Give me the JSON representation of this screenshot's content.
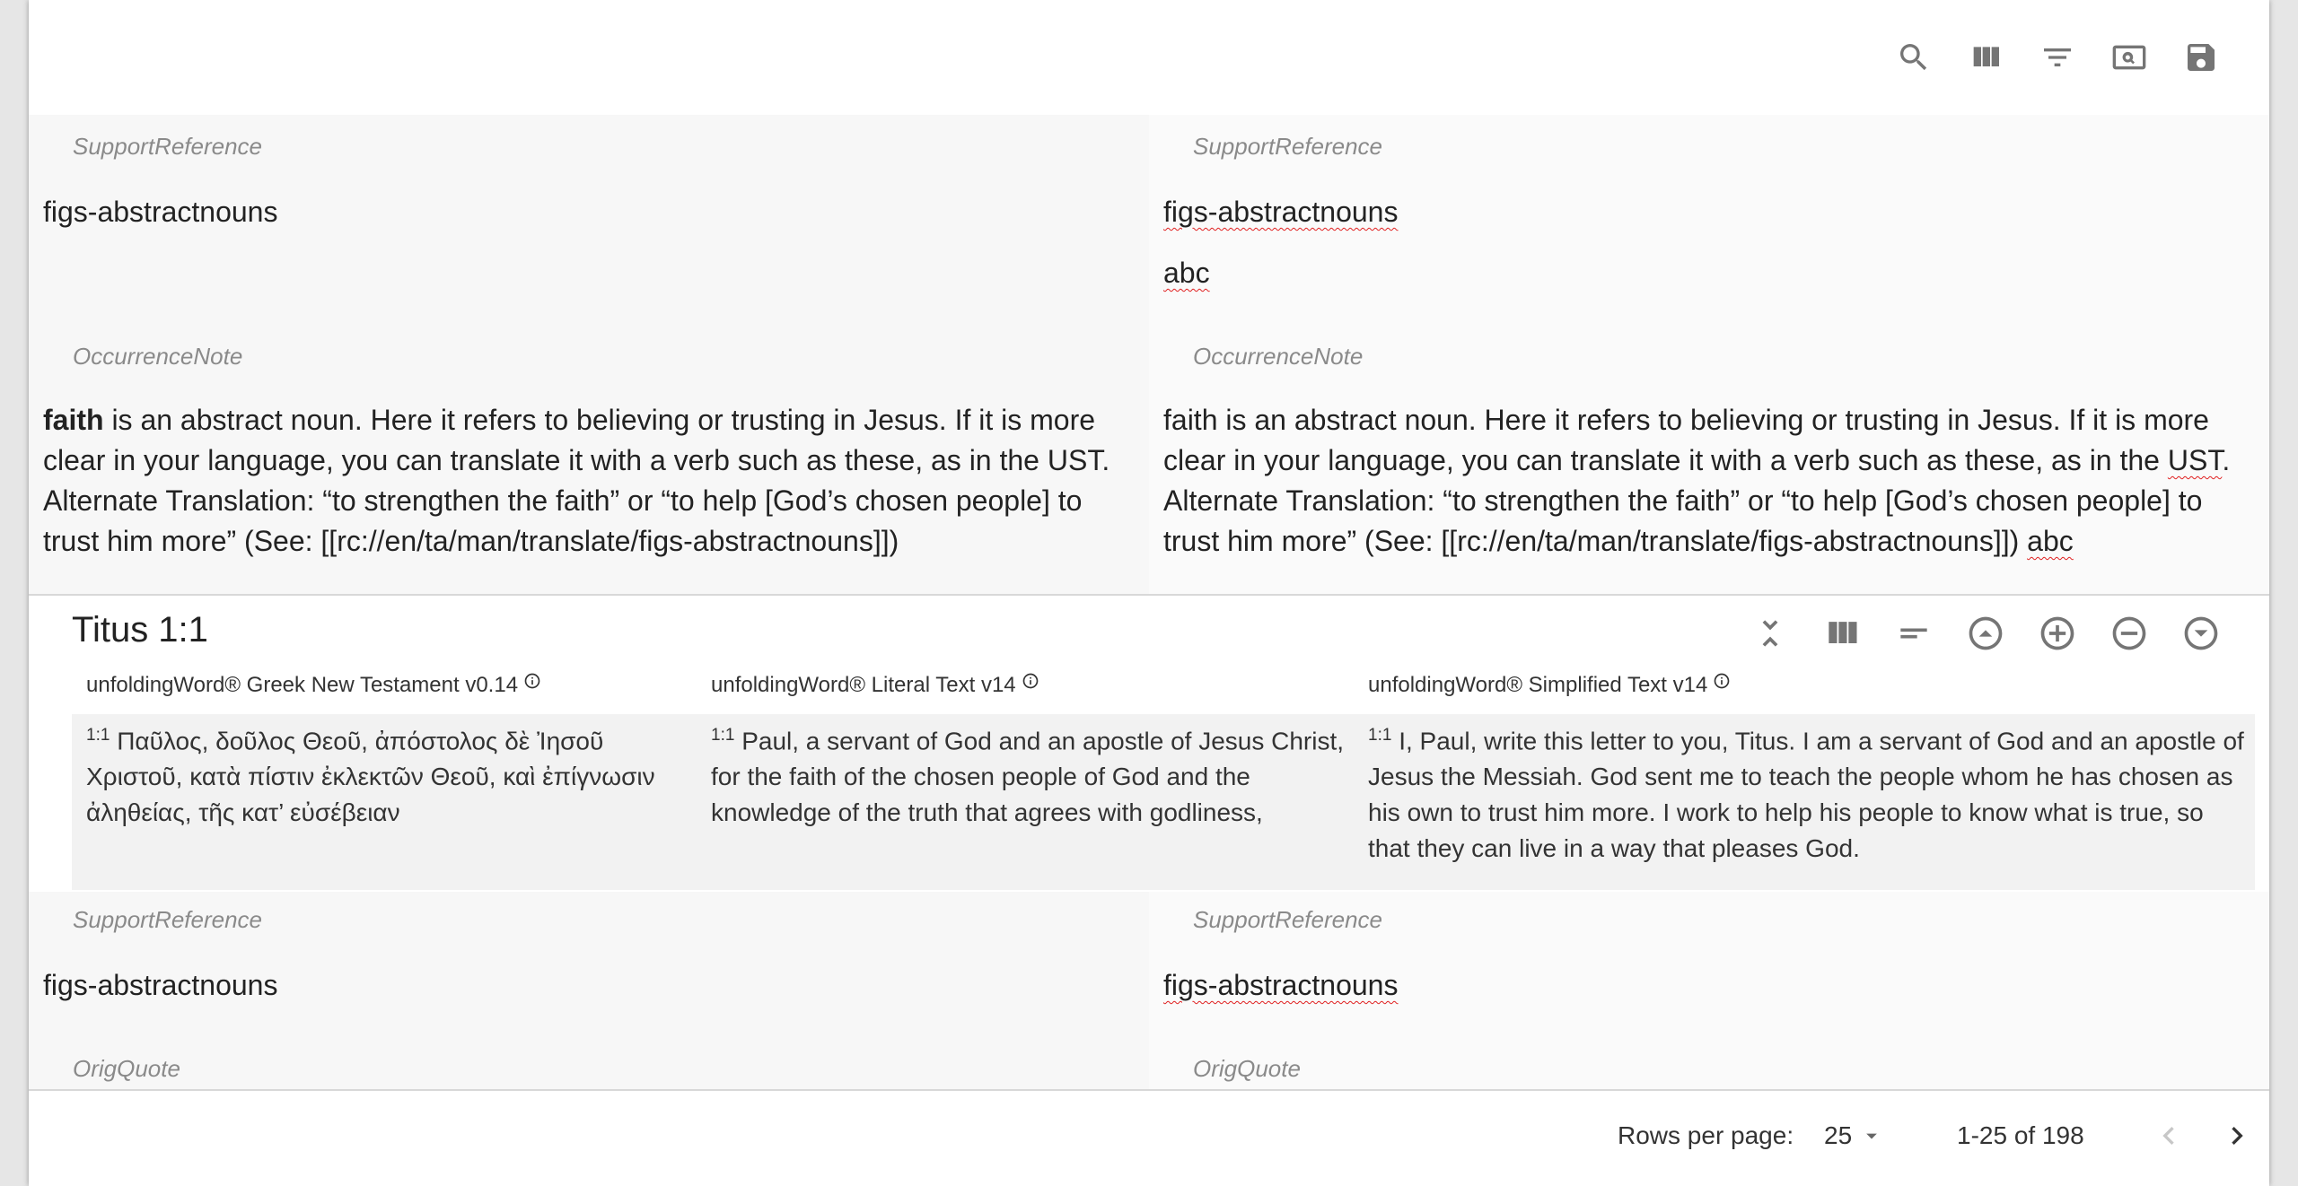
{
  "colors": {
    "label": "#8a8a8a",
    "text": "#222222",
    "icon": "#757575",
    "spellcheck": "#e02020"
  },
  "toolbar": {
    "icons": [
      "search-icon",
      "view-column-icon",
      "filter-list-icon",
      "find-in-page-icon",
      "save-icon"
    ]
  },
  "rows": [
    {
      "source": {
        "support_label": "SupportReference",
        "support_value": "figs-abstractnouns",
        "occurrence_label": "OccurrenceNote",
        "occurrence_bold": "faith",
        "occurrence_text": " is an abstract noun. Here it refers to believing or trusting in Jesus. If it is more clear in your language, you can translate it with a verb such as these, as in the UST. Alternate Translation: “to strengthen the faith” or “to help [God’s chosen people] to trust him more” (See: [[rc://en/ta/man/translate/figs-abstractnouns]])"
      },
      "target": {
        "support_label": "SupportReference",
        "support_value": "figs-abstractnouns",
        "support_extra": "abc",
        "occurrence_label": "OccurrenceNote",
        "occurrence_part1": "faith is an abstract noun. Here it refers to believing or trusting in Jesus. If it is more clear in your language, you can translate it with a verb such as these, as in the ",
        "occurrence_ust": "UST",
        "occurrence_part2": ". Alternate Translation: “to strengthen the faith” or “to help [God’s chosen people] to trust him more” (See: [[rc://en/ta/man/translate/figs-abstractnouns]]) ",
        "occurrence_abc": "abc"
      }
    },
    {
      "source": {
        "support_label": "SupportReference",
        "support_value": "figs-abstractnouns",
        "origquote_label": "OrigQuote"
      },
      "target": {
        "support_label": "SupportReference",
        "support_value": "figs-abstractnouns",
        "origquote_label": "OrigQuote"
      }
    }
  ],
  "scripture": {
    "reference": "Titus 1:1",
    "toolbar_icons": [
      "collapse-icon",
      "view-column-icon",
      "short-text-icon",
      "arrow-up-circle-icon",
      "add-circle-icon",
      "remove-circle-icon",
      "arrow-down-circle-icon"
    ],
    "versions": [
      {
        "title": "unfoldingWord® Greek New Testament v0.14",
        "verse": "1:1",
        "text": "Παῦλος, δοῦλος Θεοῦ, ἀπόστολος δὲ Ἰησοῦ Χριστοῦ, κατὰ πίστιν ἐκλεκτῶν Θεοῦ, καὶ ἐπίγνωσιν ἀληθείας, τῆς κατ’ εὐσέβειαν"
      },
      {
        "title": "unfoldingWord® Literal Text v14",
        "verse": "1:1",
        "text": "Paul, a servant of God and an apostle of Jesus Christ, for the faith of the chosen people of God and the knowledge of the truth that agrees with godliness,"
      },
      {
        "title": "unfoldingWord® Simplified Text v14",
        "verse": "1:1",
        "text": "I, Paul, write this letter to you, Titus. I am a servant of God and an apostle of Jesus the Messiah. God sent me to teach the people whom he has chosen as his own to trust him more. I work to help his people to know what is true, so that they can live in a way that pleases God."
      }
    ]
  },
  "pagination": {
    "rows_per_page_label": "Rows per page:",
    "rows_per_page_value": "25",
    "range_label": "1-25 of 198"
  }
}
